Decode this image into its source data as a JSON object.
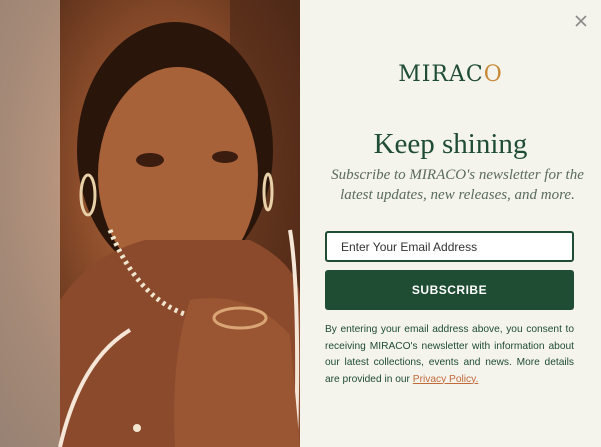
{
  "brand": {
    "name_main": "MIRAC",
    "name_accent": "O",
    "accent_color": "#c88b3a",
    "primary_color": "#1f4d33"
  },
  "popup": {
    "close_icon": "close-icon",
    "title": "Keep shining",
    "subtitle": "Subscribe to MIRACO's newsletter for the latest updates, new releases, and more.",
    "email": {
      "placeholder": "Enter Your Email Address",
      "value": ""
    },
    "subscribe_label": "SUBSCRIBE",
    "consent_text": "By entering your email address above, you consent to receiving MIRACO's newsletter with information about our latest collections, events and news. More details are provided in our",
    "privacy_link": "Privacy Policy."
  }
}
